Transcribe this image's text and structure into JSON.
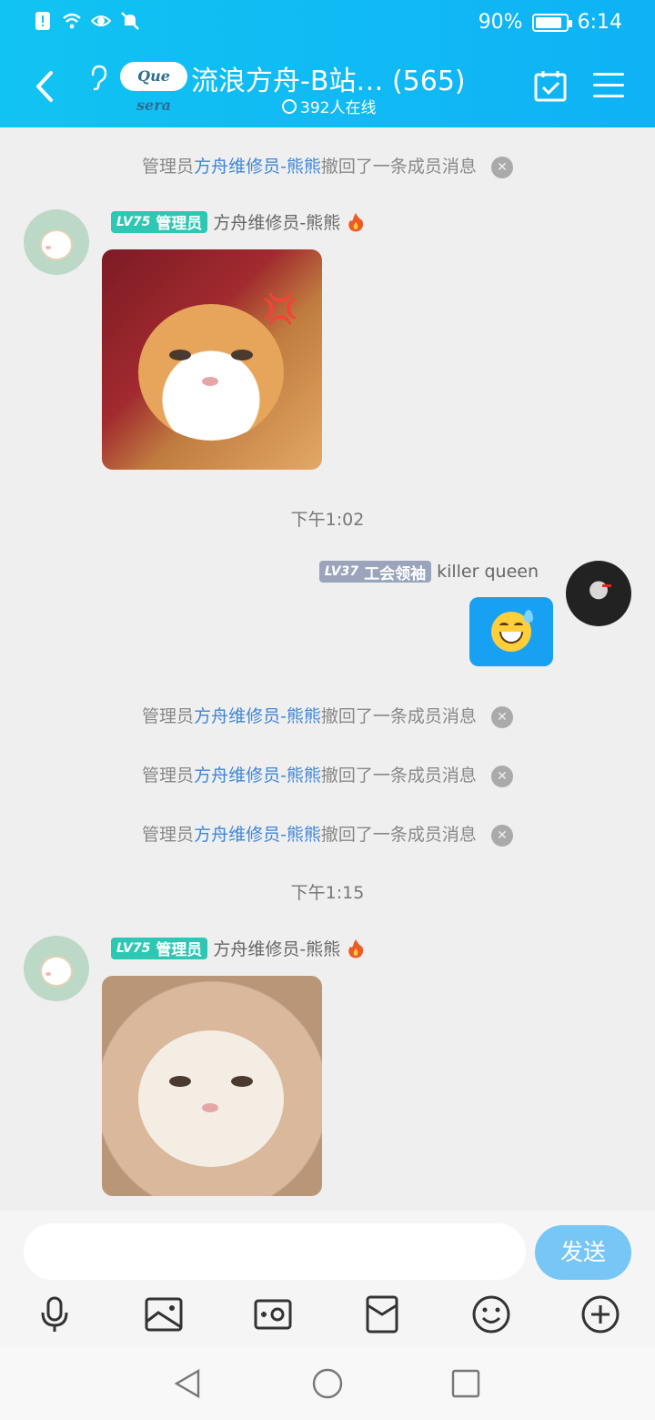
{
  "status_bar": {
    "battery_text": "90%",
    "battery_level": 0.9,
    "time": "6:14"
  },
  "header": {
    "title": "流浪方舟-B站…  (565)",
    "logo_text": "Que sera",
    "online_text": "392人在线"
  },
  "messages": {
    "recall_1": {
      "prefix": "管理员",
      "name": "方舟维修员-熊熊",
      "suffix": "撤回了一条成员消息"
    },
    "msg_1": {
      "level": "LV75",
      "role": "管理员",
      "sender": "方舟维修员-熊熊"
    },
    "time_1": "下午1:02",
    "msg_2": {
      "level": "LV37",
      "role": "工会领袖",
      "sender": "killer queen"
    },
    "recall_2": {
      "prefix": "管理员",
      "name": "方舟维修员-熊熊",
      "suffix": "撤回了一条成员消息"
    },
    "recall_3": {
      "prefix": "管理员",
      "name": "方舟维修员-熊熊",
      "suffix": "撤回了一条成员消息"
    },
    "recall_4": {
      "prefix": "管理员",
      "name": "方舟维修员-熊熊",
      "suffix": "撤回了一条成员消息"
    },
    "time_2": "下午1:15",
    "msg_3": {
      "level": "LV75",
      "role": "管理员",
      "sender": "方舟维修员-熊熊"
    }
  },
  "input": {
    "placeholder": "",
    "send_label": "发送"
  },
  "toolbar_icons": [
    "microphone-icon",
    "picture-icon",
    "camera-icon",
    "red-packet-icon",
    "emoji-icon",
    "plus-icon"
  ],
  "colors": {
    "header_bg": "#11c3f2",
    "highlight_name": "#3f86d9",
    "admin_badge": "#2ec7b3",
    "guild_badge": "#9aa5bb",
    "my_bubble": "#18a1f2",
    "send_button": "#78c6f6"
  }
}
